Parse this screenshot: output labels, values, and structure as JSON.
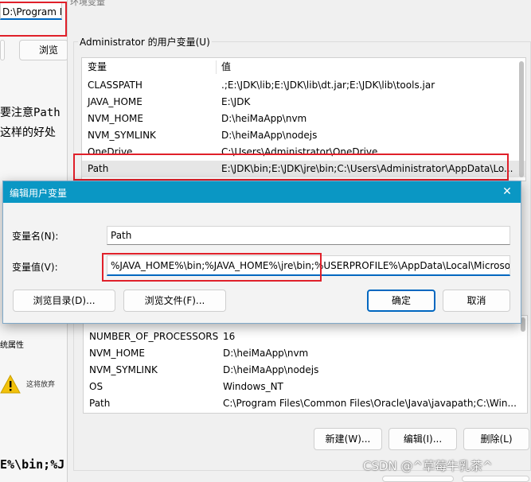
{
  "background_window": {
    "path_value": "D:\\Program Fi",
    "browse_label": "浏览",
    "note_line1": "要注意Path",
    "note_line2": "这样的好处",
    "sys_props_label": "统属性",
    "warning_text": "这将放弃",
    "bottom_text": "E%\\bin;%J"
  },
  "env_window": {
    "title": "环境变量",
    "user_group_label": "Administrator 的用户变量(U)",
    "columns": {
      "variable": "变量",
      "value": "值"
    },
    "user_vars": [
      {
        "name": "CLASSPATH",
        "value": ".;E:\\JDK\\lib;E:\\JDK\\lib\\dt.jar;E:\\JDK\\lib\\tools.jar"
      },
      {
        "name": "JAVA_HOME",
        "value": "E:\\JDK"
      },
      {
        "name": "NVM_HOME",
        "value": "D:\\heiMaApp\\nvm"
      },
      {
        "name": "NVM_SYMLINK",
        "value": "D:\\heiMaApp\\nodejs"
      },
      {
        "name": "OneDrive",
        "value": "C:\\Users\\Administrator\\OneDrive"
      },
      {
        "name": "Path",
        "value": "E:\\JDK\\bin;E:\\JDK\\jre\\bin;C:\\Users\\Administrator\\AppData\\Lo..."
      }
    ],
    "system_vars": [
      {
        "name": "NUMBER_OF_PROCESSORS",
        "value": "16"
      },
      {
        "name": "NVM_HOME",
        "value": "D:\\heiMaApp\\nvm"
      },
      {
        "name": "NVM_SYMLINK",
        "value": "D:\\heiMaApp\\nodejs"
      },
      {
        "name": "OS",
        "value": "Windows_NT"
      },
      {
        "name": "Path",
        "value": "C:\\Program Files\\Common Files\\Oracle\\Java\\javapath;C:\\Win..."
      }
    ],
    "buttons": {
      "new": "新建(W)...",
      "edit": "编辑(I)...",
      "delete": "删除(L)"
    }
  },
  "dialog": {
    "title": "编辑用户变量",
    "close_glyph": "✕",
    "name_label": "变量名(N):",
    "name_value": "Path",
    "value_label": "变量值(V):",
    "value_value": "%JAVA_HOME%\\bin;%JAVA_HOME%\\jre\\bin;%USERPROFILE%\\AppData\\Local\\Microso",
    "browse_dir": "浏览目录(D)...",
    "browse_file": "浏览文件(F)...",
    "ok": "确定",
    "cancel": "取消"
  },
  "watermark": "CSDN @^草莓牛乳茶^",
  "colors": {
    "titlebar": "#0a97c4",
    "highlight_border": "#e0202a",
    "focus": "#0067c0"
  },
  "icons": {
    "warning": "warning-icon",
    "close": "close-icon"
  }
}
